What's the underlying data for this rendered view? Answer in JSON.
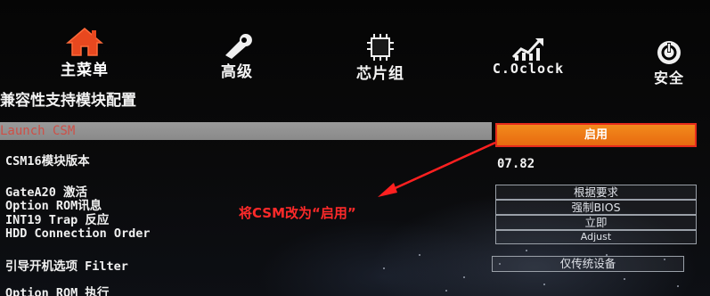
{
  "nav": {
    "items": [
      {
        "label": "主菜单",
        "icon": "home-icon",
        "active": true
      },
      {
        "label": "高级",
        "icon": "wrench-icon"
      },
      {
        "label": "芯片组",
        "icon": "chip-icon"
      },
      {
        "label": "C.Oclock",
        "icon": "overclock-chart-icon"
      },
      {
        "label": "安全",
        "icon": "security-power-icon"
      }
    ]
  },
  "page": {
    "title": "兼容性支持模块配置",
    "highlighted_option": "Launch CSM"
  },
  "settings": [
    {
      "label": "CSM16模块版本"
    },
    {
      "label": "GateA20 激活"
    },
    {
      "label": "Option ROM讯息"
    },
    {
      "label": "INT19 Trap 反应"
    },
    {
      "label": "HDD Connection Order"
    },
    {
      "label": "引导开机选项 Filter"
    },
    {
      "label": "Option ROM 执行"
    }
  ],
  "values": {
    "csm": "启用",
    "csm16_version": "07.82",
    "gatea20": "根据要求",
    "option_rom_message": "强制BIOS",
    "int19_trap": "立即",
    "hdd_order": "Adjust",
    "boot_filter": "仅传统设备"
  },
  "annotation": {
    "text": "将CSM改为“启用”",
    "color": "#ff2a2a"
  },
  "colors": {
    "accent_orange": "#f28a1c",
    "selection_border": "#e62a1c",
    "highlight_bar": "#8f8f8f"
  }
}
